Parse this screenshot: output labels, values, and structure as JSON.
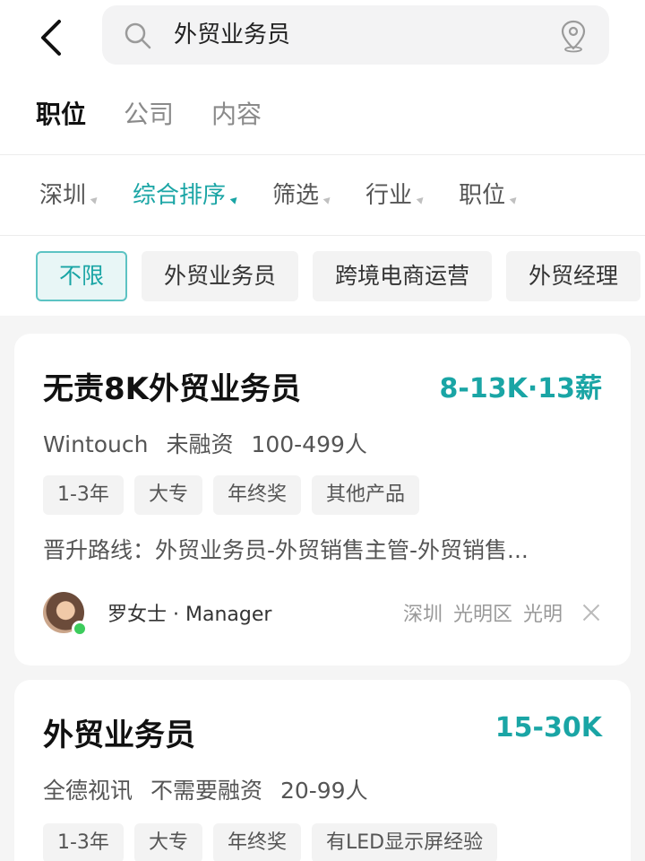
{
  "search": {
    "query": "外贸业务员"
  },
  "tabs": [
    {
      "label": "职位"
    },
    {
      "label": "公司"
    },
    {
      "label": "内容"
    }
  ],
  "filters": [
    {
      "label": "深圳"
    },
    {
      "label": "综合排序"
    },
    {
      "label": "筛选"
    },
    {
      "label": "行业"
    },
    {
      "label": "职位"
    }
  ],
  "chips": [
    {
      "label": "不限"
    },
    {
      "label": "外贸业务员"
    },
    {
      "label": "跨境电商运营"
    },
    {
      "label": "外贸经理"
    }
  ],
  "jobs": [
    {
      "title": "无责8K外贸业务员",
      "salary": "8-13K·13薪",
      "company": "Wintouch",
      "funding": "未融资",
      "size": "100-499人",
      "tags": [
        "1-3年",
        "大专",
        "年终奖",
        "其他产品"
      ],
      "description": "晋升路线：外贸业务员-外贸销售主管-外贸销售...",
      "recruiter": "罗女士 · Manager",
      "location": [
        "深圳",
        "光明区",
        "光明"
      ]
    },
    {
      "title": "外贸业务员",
      "salary": "15-30K",
      "company": "全德视讯",
      "funding": "不需要融资",
      "size": "20-99人",
      "tags": [
        "1-3年",
        "大专",
        "年终奖",
        "有LED显示屏经验"
      ]
    }
  ],
  "colors": {
    "accent": "#1aa5a5",
    "online": "#3ccc5c"
  }
}
